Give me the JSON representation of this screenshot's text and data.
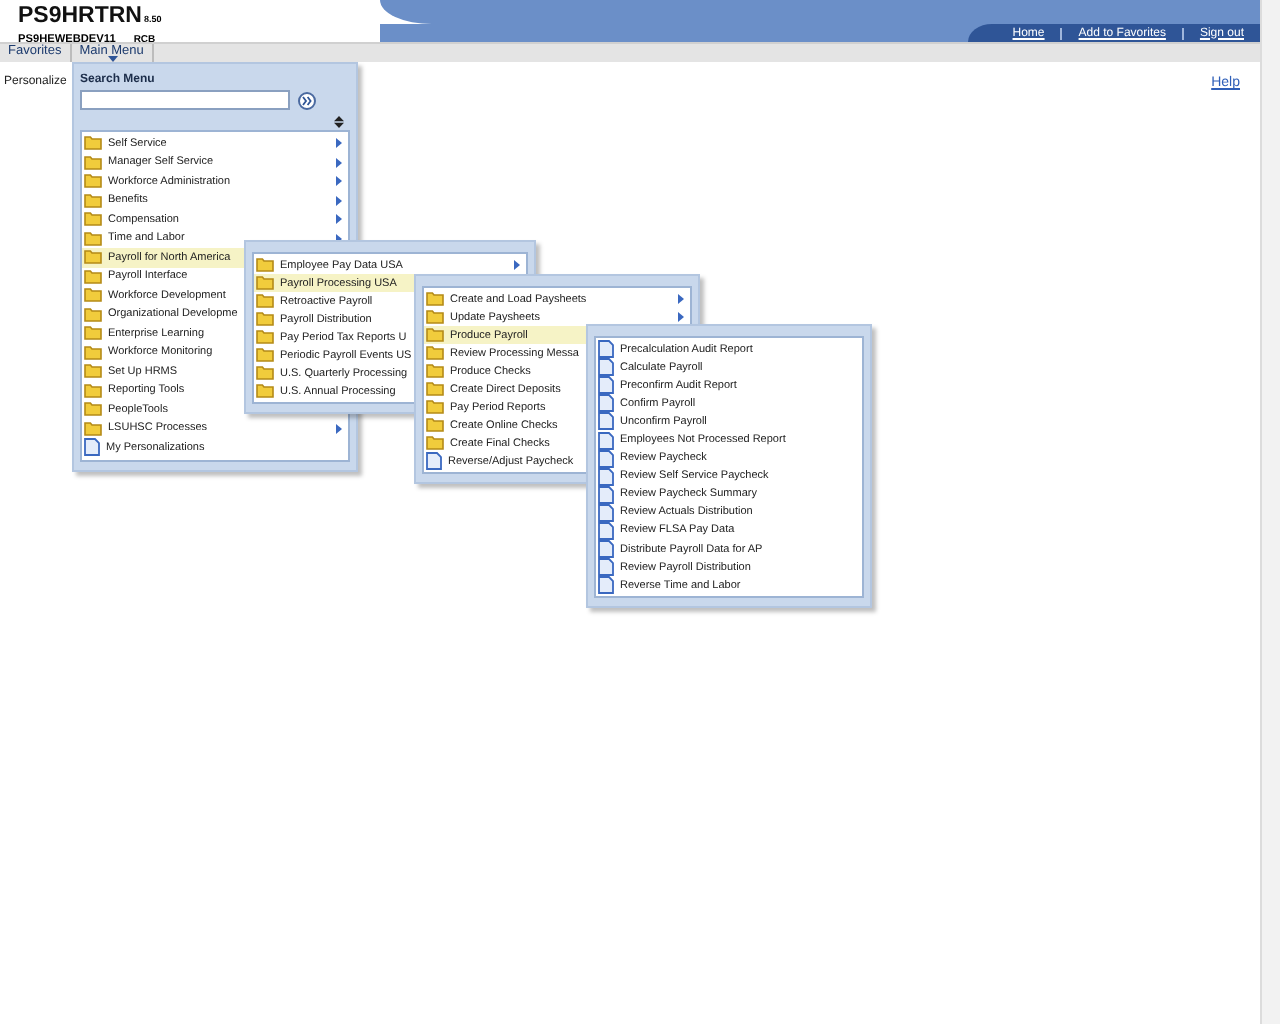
{
  "header": {
    "title": "PS9HRTRN",
    "version": "8.50",
    "server": "PS9HEWEBDEV11",
    "user": "RCB",
    "links": [
      "Home",
      "Add to Favorites",
      "Sign out"
    ]
  },
  "menubar": [
    {
      "label": "Favorites",
      "open": false
    },
    {
      "label": "Main Menu",
      "open": true
    }
  ],
  "page": {
    "title": "Personalize",
    "help": "Help"
  },
  "menus": [
    {
      "kind": "search",
      "title": "Search Menu",
      "items": [
        {
          "label": "Self Service",
          "kind": "folder",
          "selected": false,
          "submenu": true
        },
        {
          "label": "Manager Self Service",
          "kind": "folder",
          "selected": false,
          "submenu": true
        },
        {
          "label": "Workforce Administration",
          "kind": "folder",
          "selected": false,
          "submenu": true
        },
        {
          "label": "Benefits",
          "kind": "folder",
          "selected": false,
          "submenu": true
        },
        {
          "label": "Compensation",
          "kind": "folder",
          "selected": false,
          "submenu": true
        },
        {
          "label": "Time and Labor",
          "kind": "folder",
          "selected": false,
          "submenu": true
        },
        {
          "label": "Payroll for North America",
          "kind": "folder",
          "selected": true,
          "submenu": false
        },
        {
          "label": "Payroll Interface",
          "kind": "folder",
          "selected": false,
          "submenu": false
        },
        {
          "label": "Workforce Development",
          "kind": "folder",
          "selected": false,
          "submenu": false
        },
        {
          "label": "Organizational Developme",
          "kind": "folder",
          "selected": false,
          "submenu": false
        },
        {
          "label": "Enterprise Learning",
          "kind": "folder",
          "selected": false,
          "submenu": false
        },
        {
          "label": "Workforce Monitoring",
          "kind": "folder",
          "selected": false,
          "submenu": false
        },
        {
          "label": "Set Up HRMS",
          "kind": "folder",
          "selected": false,
          "submenu": false
        },
        {
          "label": "Reporting Tools",
          "kind": "folder",
          "selected": false,
          "submenu": false
        },
        {
          "label": "PeopleTools",
          "kind": "folder",
          "selected": false,
          "submenu": false
        },
        {
          "label": "LSUHSC Processes",
          "kind": "folder",
          "selected": false,
          "submenu": true
        },
        {
          "label": "My Personalizations",
          "kind": "page",
          "selected": false,
          "submenu": false
        }
      ]
    },
    {
      "kind": "flyout",
      "items": [
        {
          "label": "Employee Pay Data USA",
          "kind": "folder",
          "selected": false,
          "submenu": true
        },
        {
          "label": "Payroll Processing USA",
          "kind": "folder",
          "selected": true,
          "submenu": false
        },
        {
          "label": "Retroactive Payroll",
          "kind": "folder",
          "selected": false,
          "submenu": false
        },
        {
          "label": "Payroll Distribution",
          "kind": "folder",
          "selected": false,
          "submenu": false
        },
        {
          "label": "Pay Period Tax Reports U",
          "kind": "folder",
          "selected": false,
          "submenu": false
        },
        {
          "label": "Periodic Payroll Events US",
          "kind": "folder",
          "selected": false,
          "submenu": false
        },
        {
          "label": "U.S. Quarterly Processing",
          "kind": "folder",
          "selected": false,
          "submenu": false
        },
        {
          "label": "U.S. Annual Processing",
          "kind": "folder",
          "selected": false,
          "submenu": false
        }
      ]
    },
    {
      "kind": "flyout",
      "items": [
        {
          "label": "Create and Load Paysheets",
          "kind": "folder",
          "selected": false,
          "submenu": true
        },
        {
          "label": "Update Paysheets",
          "kind": "folder",
          "selected": false,
          "submenu": true
        },
        {
          "label": "Produce Payroll",
          "kind": "folder",
          "selected": true,
          "submenu": false
        },
        {
          "label": "Review Processing Messa",
          "kind": "folder",
          "selected": false,
          "submenu": false
        },
        {
          "label": "Produce Checks",
          "kind": "folder",
          "selected": false,
          "submenu": false
        },
        {
          "label": "Create Direct Deposits",
          "kind": "folder",
          "selected": false,
          "submenu": false
        },
        {
          "label": "Pay Period Reports",
          "kind": "folder",
          "selected": false,
          "submenu": false
        },
        {
          "label": "Create Online Checks",
          "kind": "folder",
          "selected": false,
          "submenu": false
        },
        {
          "label": "Create Final Checks",
          "kind": "folder",
          "selected": false,
          "submenu": false
        },
        {
          "label": "Reverse/Adjust Paycheck",
          "kind": "page",
          "selected": false,
          "submenu": false
        }
      ]
    },
    {
      "kind": "flyout",
      "items": [
        {
          "label": "Precalculation Audit Report",
          "kind": "page",
          "selected": false,
          "submenu": false
        },
        {
          "label": "Calculate Payroll",
          "kind": "page",
          "selected": false,
          "submenu": false
        },
        {
          "label": "Preconfirm Audit Report",
          "kind": "page",
          "selected": false,
          "submenu": false
        },
        {
          "label": "Confirm Payroll",
          "kind": "page",
          "selected": false,
          "submenu": false
        },
        {
          "label": "Unconfirm Payroll",
          "kind": "page",
          "selected": false,
          "submenu": false
        },
        {
          "label": "Employees Not Processed Report",
          "kind": "page",
          "selected": false,
          "submenu": false
        },
        {
          "label": "Review Paycheck",
          "kind": "page",
          "selected": false,
          "submenu": false
        },
        {
          "label": "Review Self Service Paycheck",
          "kind": "page",
          "selected": false,
          "submenu": false
        },
        {
          "label": "Review Paycheck Summary",
          "kind": "page",
          "selected": false,
          "submenu": false
        },
        {
          "label": "Review Actuals Distribution",
          "kind": "page",
          "selected": false,
          "submenu": false
        },
        {
          "label": "Review FLSA Pay Data",
          "kind": "page",
          "selected": false,
          "submenu": false
        },
        {
          "label": "Distribute Payroll Data for AP",
          "kind": "page",
          "selected": false,
          "submenu": false
        },
        {
          "label": "Review Payroll Distribution",
          "kind": "page",
          "selected": false,
          "submenu": false
        },
        {
          "label": "Reverse Time and Labor",
          "kind": "page",
          "selected": false,
          "submenu": false
        }
      ]
    }
  ]
}
